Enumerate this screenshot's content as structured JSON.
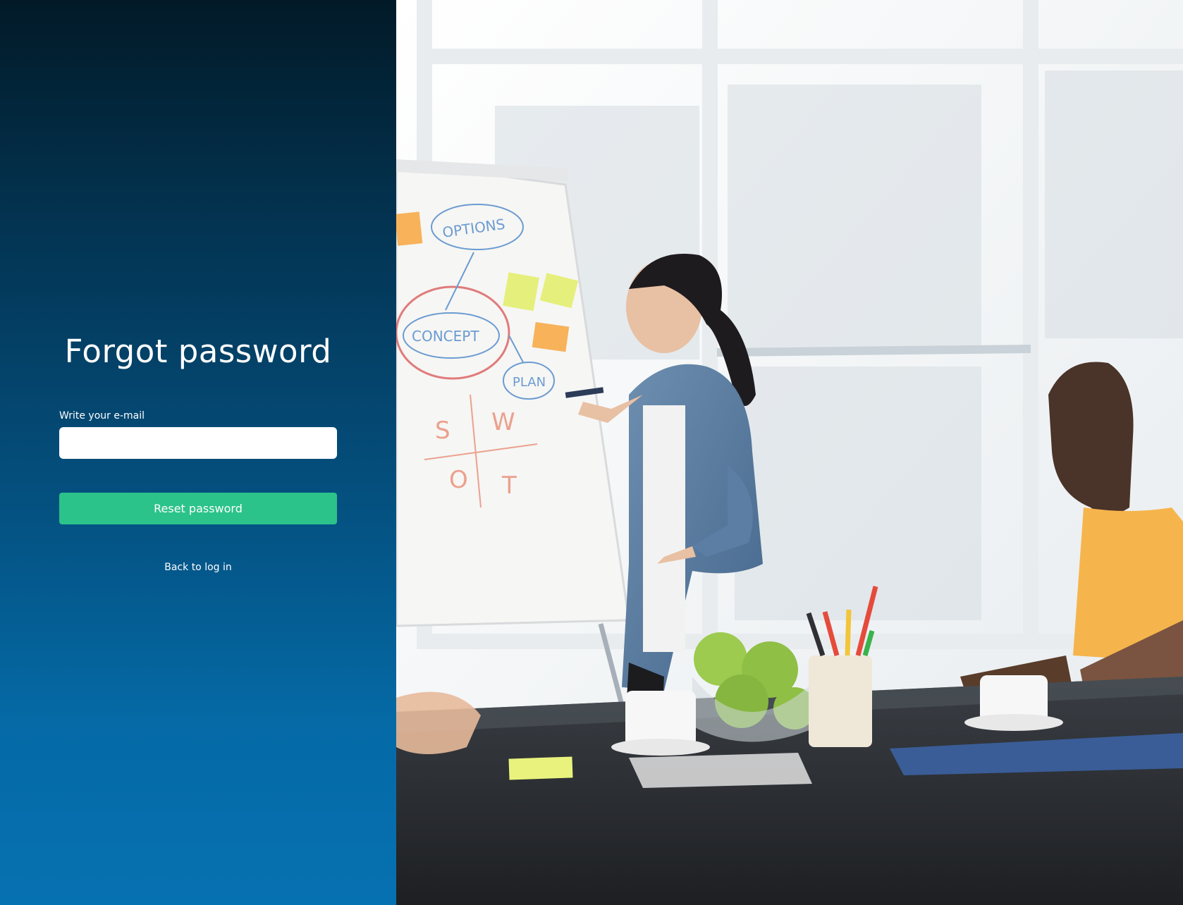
{
  "form": {
    "title": "Forgot password",
    "email_label": "Write your e-mail",
    "email_value": "",
    "email_placeholder": "",
    "submit_label": "Reset password",
    "back_link_label": "Back to log in"
  },
  "colors": {
    "panel_gradient_top": "#021a28",
    "panel_gradient_bottom": "#0671b1",
    "button_green": "#2cc38a",
    "text": "#ffffff"
  },
  "photo": {
    "description_icon": "office-meeting-photo",
    "flipchart_text": [
      "OPTIONS",
      "CONCEPT",
      "PLAN",
      "S",
      "W",
      "O",
      "T"
    ]
  }
}
